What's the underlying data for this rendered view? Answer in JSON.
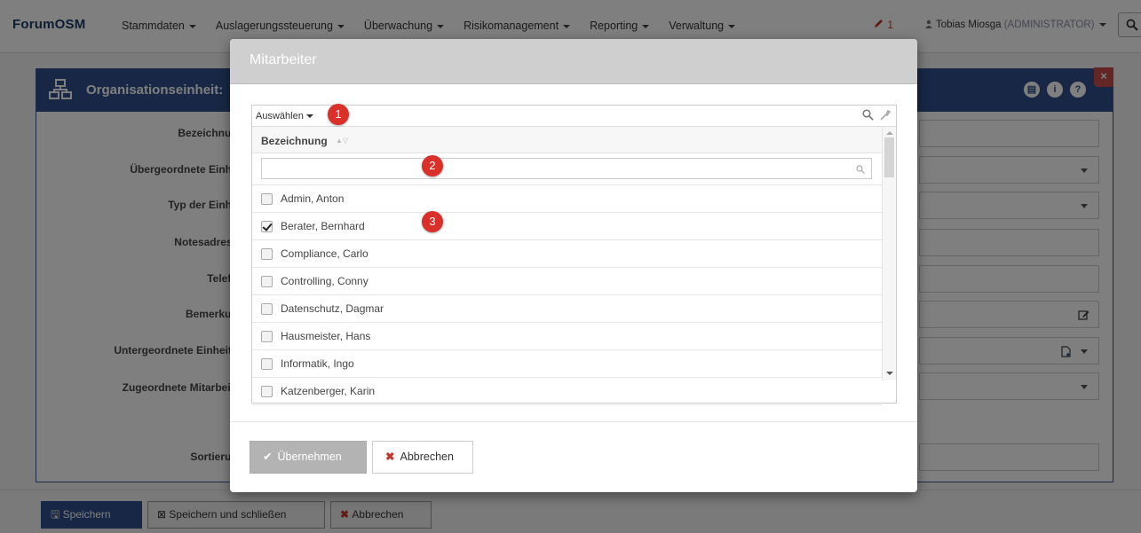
{
  "app": {
    "brand_prefix": "Forum",
    "brand_suffix": "OSM"
  },
  "nav": {
    "menus": [
      {
        "label": "Stammdaten"
      },
      {
        "label": "Auslagerungssteuerung"
      },
      {
        "label": "Überwachung"
      },
      {
        "label": "Risikomanagement"
      },
      {
        "label": "Reporting"
      },
      {
        "label": "Verwaltung"
      }
    ],
    "notification_count": "1",
    "user_name": "Tobias Miosga",
    "user_role": "(ADMINISTRATOR)"
  },
  "panel": {
    "title": "Organisationseinheit: ",
    "icons": [
      "pdf-icon",
      "info-icon",
      "help-icon"
    ],
    "close_label": "×",
    "form_labels": [
      "Bezeichnung",
      "Übergeordnete Einheit",
      "Typ der Einheit",
      "Notesadresse",
      "Telefon",
      "Bemerkung",
      "Untergeordnete Einheiten",
      "Zugeordnete Mitarbeiter",
      "Sortierung"
    ]
  },
  "footer": {
    "save_label": "Speichern",
    "save_close_label": "Speichern und schließen",
    "cancel_label": "Abbrechen"
  },
  "modal": {
    "title": "Mitarbeiter",
    "select_label": "Auswählen",
    "column_header": "Bezeichnung",
    "sort_indicator": "▲▽",
    "filter_value": "",
    "employees": [
      {
        "name": "Admin, Anton",
        "checked": false
      },
      {
        "name": "Berater, Bernhard",
        "checked": true
      },
      {
        "name": "Compliance, Carlo",
        "checked": false
      },
      {
        "name": "Controlling, Conny",
        "checked": false
      },
      {
        "name": "Datenschutz, Dagmar",
        "checked": false
      },
      {
        "name": "Hausmeister, Hans",
        "checked": false
      },
      {
        "name": "Informatik, Ingo",
        "checked": false
      },
      {
        "name": "Katzenberger, Karin",
        "checked": false
      }
    ],
    "ok_label": "Übernehmen",
    "cancel_label": "Abbrechen"
  },
  "callouts": [
    "1",
    "2",
    "3"
  ],
  "colors": {
    "brand_blue": "#2e4f8a",
    "callout_red": "#d9302a",
    "cancel_x_red": "#c0392b"
  }
}
